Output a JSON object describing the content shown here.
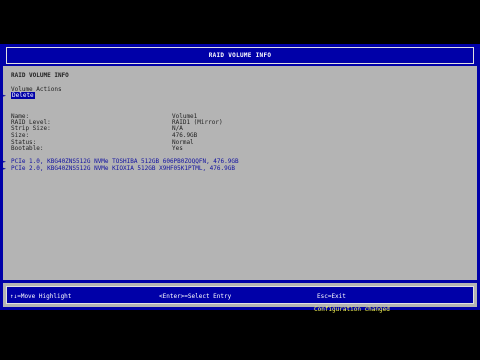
{
  "header": {
    "title": "RAID VOLUME INFO"
  },
  "content": {
    "section_title": "RAID VOLUME INFO",
    "volume_actions_label": "Volume Actions",
    "delete_label": "Delete",
    "fields": [
      {
        "label": "Name:",
        "value": "Volume1"
      },
      {
        "label": "RAID Level:",
        "value": "RAID1 (Mirror)"
      },
      {
        "label": "Strip Size:",
        "value": "N/A"
      },
      {
        "label": "Size:",
        "value": "476.9GB"
      },
      {
        "label": "Status:",
        "value": "Normal"
      },
      {
        "label": "Bootable:",
        "value": "Yes"
      }
    ],
    "disks": [
      "PCIe 1.0, KBG40ZNS512G NVMe TOSHIBA 512GB 606PB0ZOQQFN, 476.9GB",
      "PCIe 2.0, KBG40ZNS512G NVMe KIOXIA 512GB X9HF05K1PTML, 476.9GB"
    ]
  },
  "footer": {
    "move": "↑↓=Move Highlight",
    "select": "<Enter>=Select Entry",
    "exit": "Esc=Exit"
  },
  "status_message": "Configuration changed",
  "colors": {
    "bios_blue": "#0000a8",
    "panel_gray": "#b4b4b4",
    "status_yellow": "#ffff55"
  }
}
